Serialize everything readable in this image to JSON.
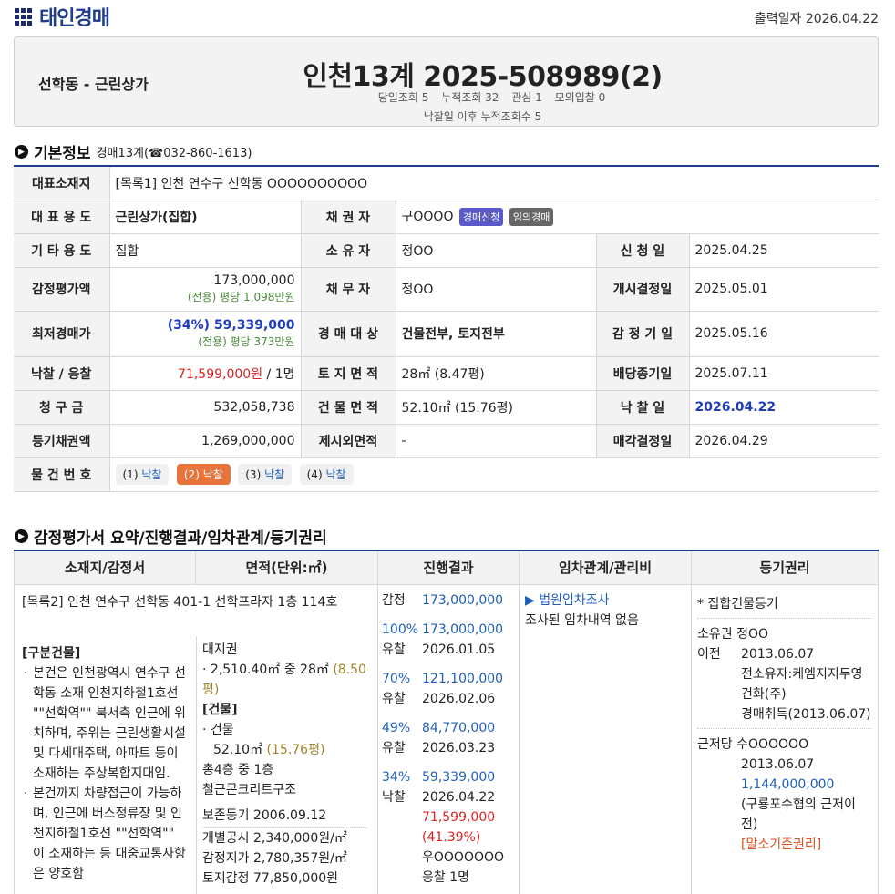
{
  "brand": {
    "logo_text": "태인경매"
  },
  "print_date": "출력일자 2026.04.22",
  "header": {
    "location_type": "선학동 - 근린상가",
    "case_no": "인천13계 2025-508989(2)",
    "stats": [
      "당일조회 5",
      "누적조회 32",
      "관심 1",
      "모의입찰 0"
    ],
    "stats2": "낙찰일 이후 누적조회수 5"
  },
  "basic": {
    "title": "기본정보",
    "court": "경매13계(☎032-860-1613)",
    "rep_address_label": "대표소재지",
    "rep_address": "[목록1] 인천 연수구 선학동 OOOOOOOOOO",
    "rows": {
      "r1": {
        "l1": "대 표 용 도",
        "v1": "근린상가(집합)",
        "l2": "채 권 자",
        "v2": "구OOOO",
        "badge1": "경매신청",
        "badge2": "임의경매"
      },
      "r2": {
        "l1": "기 타 용 도",
        "v1": "집합",
        "l2": "소 유 자",
        "v2": "정OO",
        "l3": "신 청 일",
        "v3": "2025.04.25"
      },
      "r3": {
        "l1": "감정평가액",
        "v1": "173,000,000",
        "v1b": "(전용) 평당 1,098만원",
        "l2": "채 무 자",
        "v2": "정OO",
        "l3": "개시결정일",
        "v3": "2025.05.01"
      },
      "r4": {
        "l1": "최저경매가",
        "v1a": "(34%)",
        "v1": "59,339,000",
        "v1b": "(전용) 평당 373만원",
        "l2": "경 매 대 상",
        "v2": "건물전부, 토지전부",
        "l3": "감 정 기 일",
        "v3": "2025.05.16"
      },
      "r5": {
        "l1": "낙찰 / 응찰",
        "v1": "71,599,000원",
        "v1b": " / 1명",
        "l2": "토 지 면 적",
        "v2": "28㎡ (8.47평)",
        "l3": "배당종기일",
        "v3": "2025.07.11"
      },
      "r6": {
        "l1": "청 구 금",
        "v1": "532,058,738",
        "l2": "건 물 면 적",
        "v2": "52.10㎡ (15.76평)",
        "l3": "낙 찰 일",
        "v3": "2026.04.22"
      },
      "r7": {
        "l1": "등기채권액",
        "v1": "1,269,000,000",
        "l2": "제시외면적",
        "v2": "-",
        "l3": "매각결정일",
        "v3": "2026.04.29"
      }
    },
    "items_label": "물 건 번 호",
    "items": [
      {
        "n": "(1)",
        "s": "낙찰"
      },
      {
        "n": "(2)",
        "s": "낙찰"
      },
      {
        "n": "(3)",
        "s": "낙찰"
      },
      {
        "n": "(4)",
        "s": "낙찰"
      }
    ]
  },
  "summary": {
    "title": "감정평가서 요약/진행결과/임차관계/등기권리",
    "headers": [
      "소재지/감정서",
      "면적(단위:㎡)",
      "진행결과",
      "임차관계/관리비",
      "등기권리"
    ],
    "address": "[목록2] 인천 연수구 선학동 401-1 선학프라자 1층 114호",
    "building_title": "[구분건물]",
    "bullets": [
      "본건은 인천광역시 연수구 선학동 소재 인천지하철1호선 \"\"선학역\"\" 북서측 인근에 위치하며, 주위는 근린생활시설 및 다세대주택, 아파트 등이 소재하는 주상복합지대임.",
      "본건까지 차량접근이 가능하며, 인근에 버스정류장 및 인천지하철1호선 \"\"선학역\"\" 이 소재하는 등 대중교통사항은 양호함"
    ],
    "area": {
      "land_title": "대지권",
      "land": "2,510.40㎡ 중 28㎡",
      "land_py": "(8.50평)",
      "bldg_title": "[건물]",
      "bldg": "건물",
      "bldg_area": "52.10㎡",
      "bldg_py": "(15.76평)",
      "floors": "총4층 중 1층",
      "struct": "철근콘크리트구조",
      "reg": "보존등기  2006.09.12",
      "pub": "개별공시 2,340,000원/㎡",
      "appr": "감정지가 2,780,357원/㎡",
      "land_price": "토지감정 77,850,000원"
    },
    "progress": {
      "appr_label": "감정",
      "appr_val": "173,000,000",
      "rounds": [
        {
          "pct": "100%",
          "val": "173,000,000",
          "st": "유찰",
          "date": "2026.01.05"
        },
        {
          "pct": "70%",
          "val": "121,100,000",
          "st": "유찰",
          "date": "2026.02.06"
        },
        {
          "pct": "49%",
          "val": "84,770,000",
          "st": "유찰",
          "date": "2026.03.23"
        },
        {
          "pct": "34%",
          "val": "59,339,000",
          "st": "낙찰",
          "date": "2026.04.22"
        }
      ],
      "win_price": "71,599,000",
      "win_pct": "(41.39%)",
      "winner": "우OOOOOOO",
      "bidders": "응찰 1명"
    },
    "lease": {
      "link": "▶ 법원임차조사",
      "note": "조사된 임차내역 없음"
    },
    "rights": {
      "head": "* 집합건물등기",
      "own_label": "소유권",
      "own_name": "정OO",
      "own_sub": "이전",
      "own_date": "2013.06.07",
      "own_prev": "전소유자:케엠지지두영건화(주)",
      "own_cause": "경매취득(2013.06.07)",
      "mort_label": "근저당",
      "mort_name": "수OOOOOO",
      "mort_date": "2013.06.07",
      "mort_amt": "1,144,000,000",
      "mort_note": "(구룡포수협의 근저이전)",
      "mort_tag": "[말소기준권리]"
    }
  },
  "colors": {
    "brand": "#1f3d8a",
    "accent": "#e8743b",
    "link": "#1f5fbb",
    "red": "#d22"
  }
}
